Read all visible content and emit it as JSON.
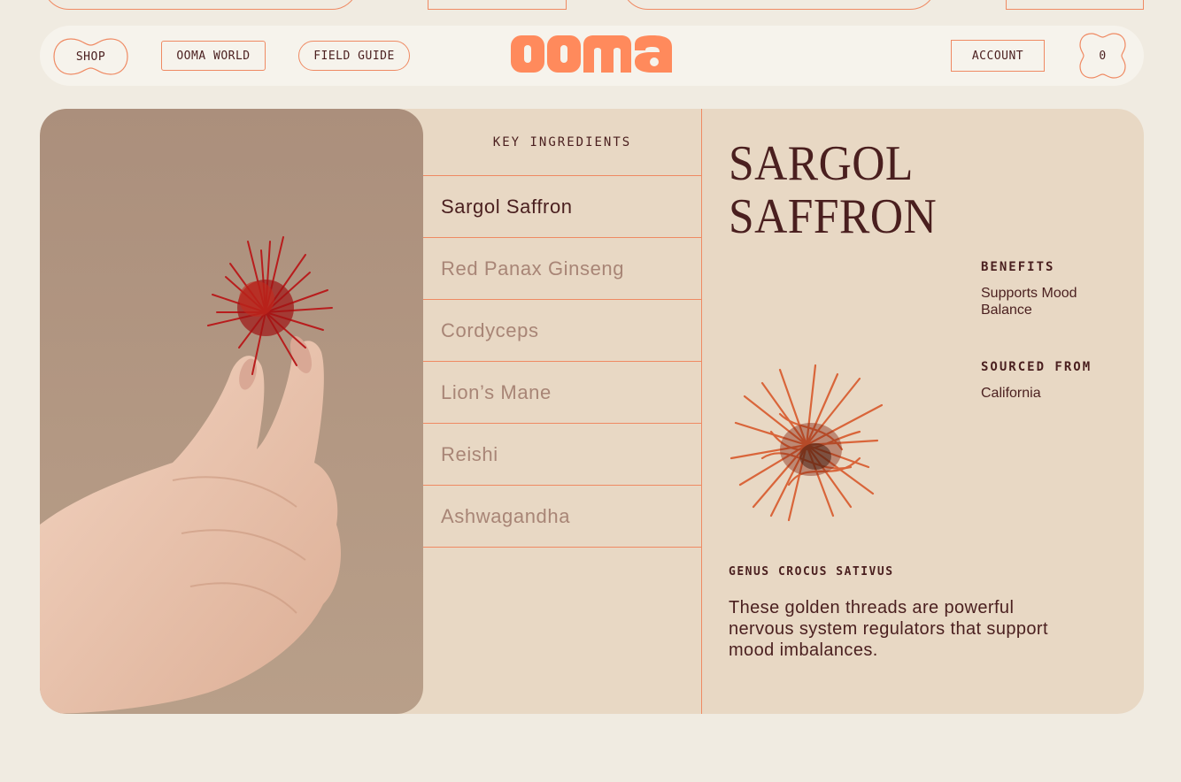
{
  "nav": {
    "shop": "SHOP",
    "world": "OOMA WORLD",
    "guide": "FIELD GUIDE",
    "logo": "ooma",
    "account": "ACCOUNT",
    "cart_count": "0"
  },
  "ingredients": {
    "heading": "KEY INGREDIENTS",
    "items": [
      {
        "label": "Sargol Saffron",
        "active": true
      },
      {
        "label": "Red Panax Ginseng",
        "active": false
      },
      {
        "label": "Cordyceps",
        "active": false
      },
      {
        "label": "Lion’s Mane",
        "active": false
      },
      {
        "label": "Reishi",
        "active": false
      },
      {
        "label": "Ashwagandha",
        "active": false
      }
    ]
  },
  "detail": {
    "title_line1": "SARGOL",
    "title_line2": "SAFFRON",
    "benefits_label": "BENEFITS",
    "benefits_value": "Supports Mood Balance",
    "sourced_label": "SOURCED FROM",
    "sourced_value": "California",
    "genus": "GENUS CROCUS SATIVUS",
    "description": "These golden threads are powerful nervous system regulators that support mood imbalances."
  },
  "colors": {
    "accent": "#ef8a63",
    "text": "#4a1f1f",
    "muted": "#a88576",
    "card": "#e8d8c4",
    "page": "#f0ebe1"
  }
}
